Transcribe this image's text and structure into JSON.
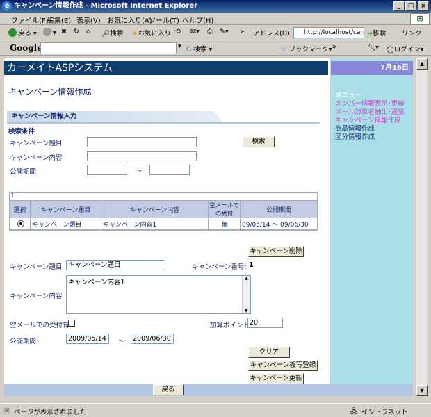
{
  "window": {
    "title": "キャンペーン情報作成 - Microsoft Internet Explorer"
  },
  "menubar": {
    "items": [
      "ファイル(F)",
      "編集(E)",
      "表示(V)",
      "お気に入り(A)",
      "ツール(T)",
      "ヘルプ(H)"
    ]
  },
  "toolbar": {
    "back": "戻る",
    "search": "検索",
    "favorites": "お気に入り",
    "address_label": "アドレス(D)",
    "address_value": "http://localhost/carm",
    "go": "移動",
    "links": "リンク"
  },
  "googlebar": {
    "logo": "Google",
    "search": "検索",
    "bookmarks": "ブックマーク",
    "login": "ログイン"
  },
  "header": {
    "app_title": "カーメイトASPシステム",
    "date": "7月16日"
  },
  "page": {
    "title": "キャンペーン情報作成",
    "section": "キャンペーン情報入力",
    "search_criteria": "検索条件"
  },
  "search_form": {
    "title_label": "キャンペーン題目",
    "content_label": "キャンペーン内容",
    "period_label": "公開期間",
    "tilde": "～",
    "search_button": "検索"
  },
  "results": {
    "count": "1",
    "columns": [
      "選択",
      "キャンペーン題目",
      "キャンペーン内容",
      "空メールでの受付",
      "公開期間"
    ],
    "rows": [
      [
        "",
        "キャンペーン題目",
        "キャンペーン内容1",
        "無",
        "09/05/14 ～ 09/06/30"
      ]
    ]
  },
  "detail": {
    "delete_button": "キャンペーン削除",
    "title_label": "キャンペーン題目",
    "title_value": "キャンペーン題目",
    "number_label": "キャンペーン番号:",
    "number_value": "1",
    "content_label": "キャンペーン内容",
    "content_value": "キャンペーン内容1",
    "empty_mail_label": "空メールでの受付有",
    "points_label": "加算ポイント",
    "points_value": "20",
    "period_label": "公開期間",
    "period_from": "2009/05/14",
    "tilde": "～",
    "period_to": "2009/06/30",
    "clear_button": "クリア",
    "copy_button": "キャンペーン複写登録",
    "update_button": "キャンペーン更新",
    "back_button": "戻る"
  },
  "sidebar": {
    "menu_header": "メニュー",
    "items": [
      {
        "label": "メンバー情報表示･更新",
        "color": "#cc44cc"
      },
      {
        "label": "メール対象者抽出･送信",
        "color": "#cc44cc"
      },
      {
        "label": "キャンペーン情報作成",
        "color": "#cc44cc"
      },
      {
        "label": "商品情報作成",
        "color": "#1a2a6a"
      },
      {
        "label": "区分情報作成",
        "color": "#1a2a6a"
      }
    ]
  },
  "statusbar": {
    "text": "ページが表示されました",
    "zone": "イントラネット"
  }
}
